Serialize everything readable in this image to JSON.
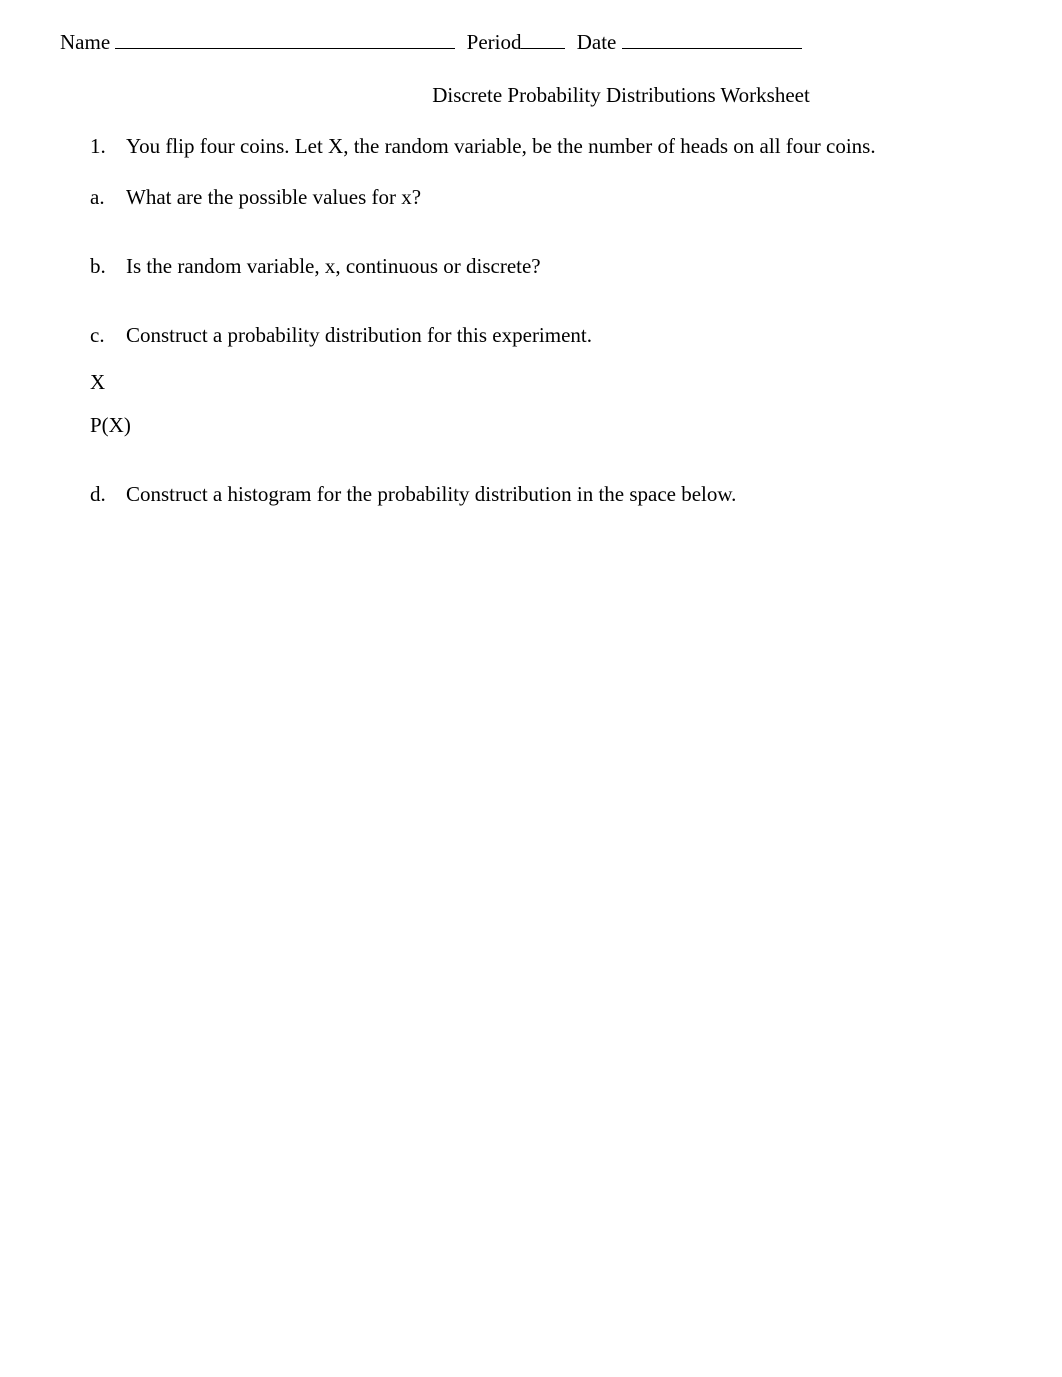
{
  "header": {
    "name_label": "Name",
    "period_label": "Period",
    "date_label": "Date"
  },
  "title": "Discrete Probability Distributions Worksheet",
  "questions": {
    "q1": {
      "marker": "1.",
      "text": "You flip four coins. Let X, the random variable, be the number of heads on all four coins."
    },
    "qa": {
      "marker": "a.",
      "text": "What are the possible values for x?"
    },
    "qb": {
      "marker": "b.",
      "text": "Is the random variable, x, continuous or discrete?"
    },
    "qc": {
      "marker": "c.",
      "text": "Construct a probability distribution for this experiment."
    },
    "table": {
      "x_label": "X",
      "px_label": "P(X)"
    },
    "qd": {
      "marker": "d.",
      "text": "Construct a histogram for the probability distribution in the space below."
    }
  }
}
